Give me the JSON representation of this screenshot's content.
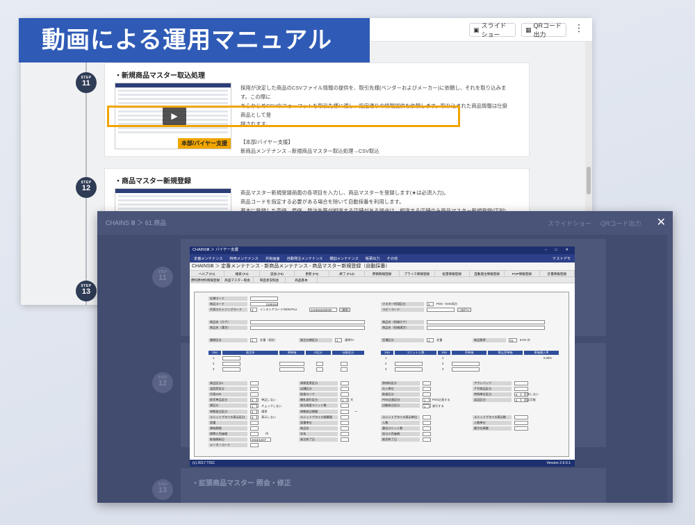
{
  "banner": {
    "title": "動画による運用マニュアル"
  },
  "toolbar": {
    "slideshow_label": "スライドショー",
    "qr_label": "QRコード出力",
    "menu_icon": "kebab-icon"
  },
  "steps": [
    {
      "label": "STEP",
      "number": "11",
      "title": "・新規商品マスター取込処理",
      "thumb_tag": "本部/バイヤー支援",
      "desc": [
        "採用が決定した商品のCSVファイル情報の提供を、取引先様(ベンダーおよびメーカー)に依頼し、それを取り込みます。この際に",
        "あらかじめCSVのフォーマットを取引先様に渡し、指定通りの情報提供を依頼します。取り込まれた商品情報は仕掛商品として登",
        "録されます。",
        "",
        "【本部/バイヤー支援】",
        "新商品メンテナンス→新規商品マスター取込処理→CSV取込"
      ]
    },
    {
      "label": "STEP",
      "number": "12",
      "title": "・商品マスター新規登録",
      "desc": [
        "商品マスター新規登録画面の各項目を入力し、商品マスターを登録します(★は必須入力)。",
        "商品コードを指定する必要がある場合を除いて自動採番を利用します。",
        "基本に登録した売価、原価、発注先等が相違する店舗がある場合は、相違する店舗のみ商品マスター新規登録(店別)を使用して登"
      ]
    },
    {
      "label": "STEP",
      "number": "13"
    }
  ],
  "overlay": {
    "breadcrumb": "CHAINS Ⅲ ＞ 61.商品",
    "close_icon": "close-icon",
    "ghost_slideshow": "スライドショー",
    "ghost_qr": "QRコード出力",
    "ghost_steps": [
      "11",
      "12",
      "13"
    ],
    "ghost_step13_title": "・拡張商品マスター 照会・修正"
  },
  "app": {
    "window_title": "CHAINSⅢ ＞ バイヤー支援",
    "menu": [
      "定番メンテナンス",
      "特売メンテナンス",
      "共有画面",
      "自動発注メンテナンス",
      "棚割メンテナンス",
      "帳票出力",
      "その他"
    ],
    "user": "テストデモ",
    "screen_title": "CHAINSⅢ ＞ 定番メンテナンス - 新商品メンテナンス - 商品マスター新規登録（自動採番）",
    "fkeys": [
      "ヘルプ (F1)",
      "検索 (F4)",
      "追加 (F5)",
      "更新 (F9)",
      "終了 (F12)",
      "原価情報登録",
      "プライス情報登録",
      "拡張情報登録",
      "自動発注情報登録",
      "POP情報登録",
      "計量情報登録"
    ],
    "subtabs": [
      "原料原材料情報登録",
      "商品マスター照会",
      "単品状況照会",
      "商品基本"
    ],
    "fields": {
      "shisaku_code": "仕様コード",
      "shohin_code": "商品コード",
      "shohin_code_val": "2189154",
      "daihyo_scan": "代表スキャニングコード",
      "instore_label": "インストアコード/NON-PLU",
      "instore_num": "4",
      "scan_val": "2218915000000",
      "master_kbn": "マスター利用区分",
      "master_num": "3",
      "master_val": "POS・EOS両方",
      "copy_code": "コピーコード",
      "copy_btn": "コピー",
      "apply_btn": "適用",
      "kana_name": "商品名（カナ）",
      "kanji_name": "商品名（漢字）",
      "short_kana": "商品名（短縮カナ）",
      "short_kanji": "商品名（短縮漢字）",
      "ikyoku": "業態区分",
      "ikyoku_num": "1",
      "ikyoku_val": "定番（固定）",
      "hacchu_kbn": "発注仕様区分",
      "hacchu_num": "1",
      "hacchu_val": "通常TA",
      "hanbai_kbn": "売場区分",
      "hanbai_num": "1",
      "hanbai_val": "定番",
      "zeiritsu": "商品税率",
      "zeiritsu_num": "01",
      "zeiritsu_val": "8.0% 外",
      "right_pct": "0.00%"
    },
    "table1_headers": [
      "1No",
      "発注先",
      "原単価",
      "D区分",
      "仕掛区分"
    ],
    "table2_headers": [
      "1No",
      "ユニット入数",
      "1No",
      "売単価",
      "税込売単価",
      "原価値入率"
    ],
    "rows": [
      "1",
      "2",
      "3"
    ],
    "lower": {
      "col1": [
        "商品区分1",
        "温度帯区分",
        "代表JAN",
        "即売単品区分",
        "便区分",
        "単数発注区分",
        "ユニットプライス表示区分",
        "容量",
        "賞味期限",
        "標準小売価格",
        "取扱開始日",
        "メーカーコード"
      ],
      "col1_vals": {
        "r4n": "0",
        "r4v": "単品しない",
        "r5n": "1",
        "r5v": "チェックしない",
        "r6n": "0",
        "r6v": "通常",
        "r7n": "0",
        "r7v": "表示しない",
        "price_unit": "円",
        "date": "2018/12/07"
      },
      "col2": [
        "季節変更区分",
        "店舗区分",
        "取扱ランク",
        "棚札発行区分",
        "発注限度ユニット数",
        "単数発注期間",
        "ユニットプライス換算値",
        "容量単位",
        "商品名",
        "年年",
        "発注終了日"
      ],
      "col2_vals": {
        "tana_num": "1",
        "tana_val": "大",
        "range_sep": "～"
      },
      "col3": [
        "原材料区分",
        "仕入単位",
        "取扱区分",
        "POS企画区分",
        "自動発注区分",
        "",
        "ユニットプライス表示単位",
        "入数",
        "重社ユニット数",
        "低公小売価格",
        "販売終了日"
      ],
      "col3_vals": {
        "pos_num": "1",
        "pos_val": "POS企画する",
        "auto_num": "1",
        "auto_val": "発行する"
      },
      "col4": [
        "アウトバック",
        "ＰＢ商品区分",
        "特殊単位区分",
        "返品区分",
        "",
        "",
        "ユニットプライス表示数",
        "入数単位",
        "最大在庫量"
      ],
      "col4_vals": {
        "tokushu_num": "0",
        "tokushu_val": "区別しない",
        "henpin_num": "2",
        "henpin_val": "返品可能"
      }
    },
    "footer_left": "(c) 2017 TISC",
    "footer_right": "Version 2.6.0.1"
  }
}
